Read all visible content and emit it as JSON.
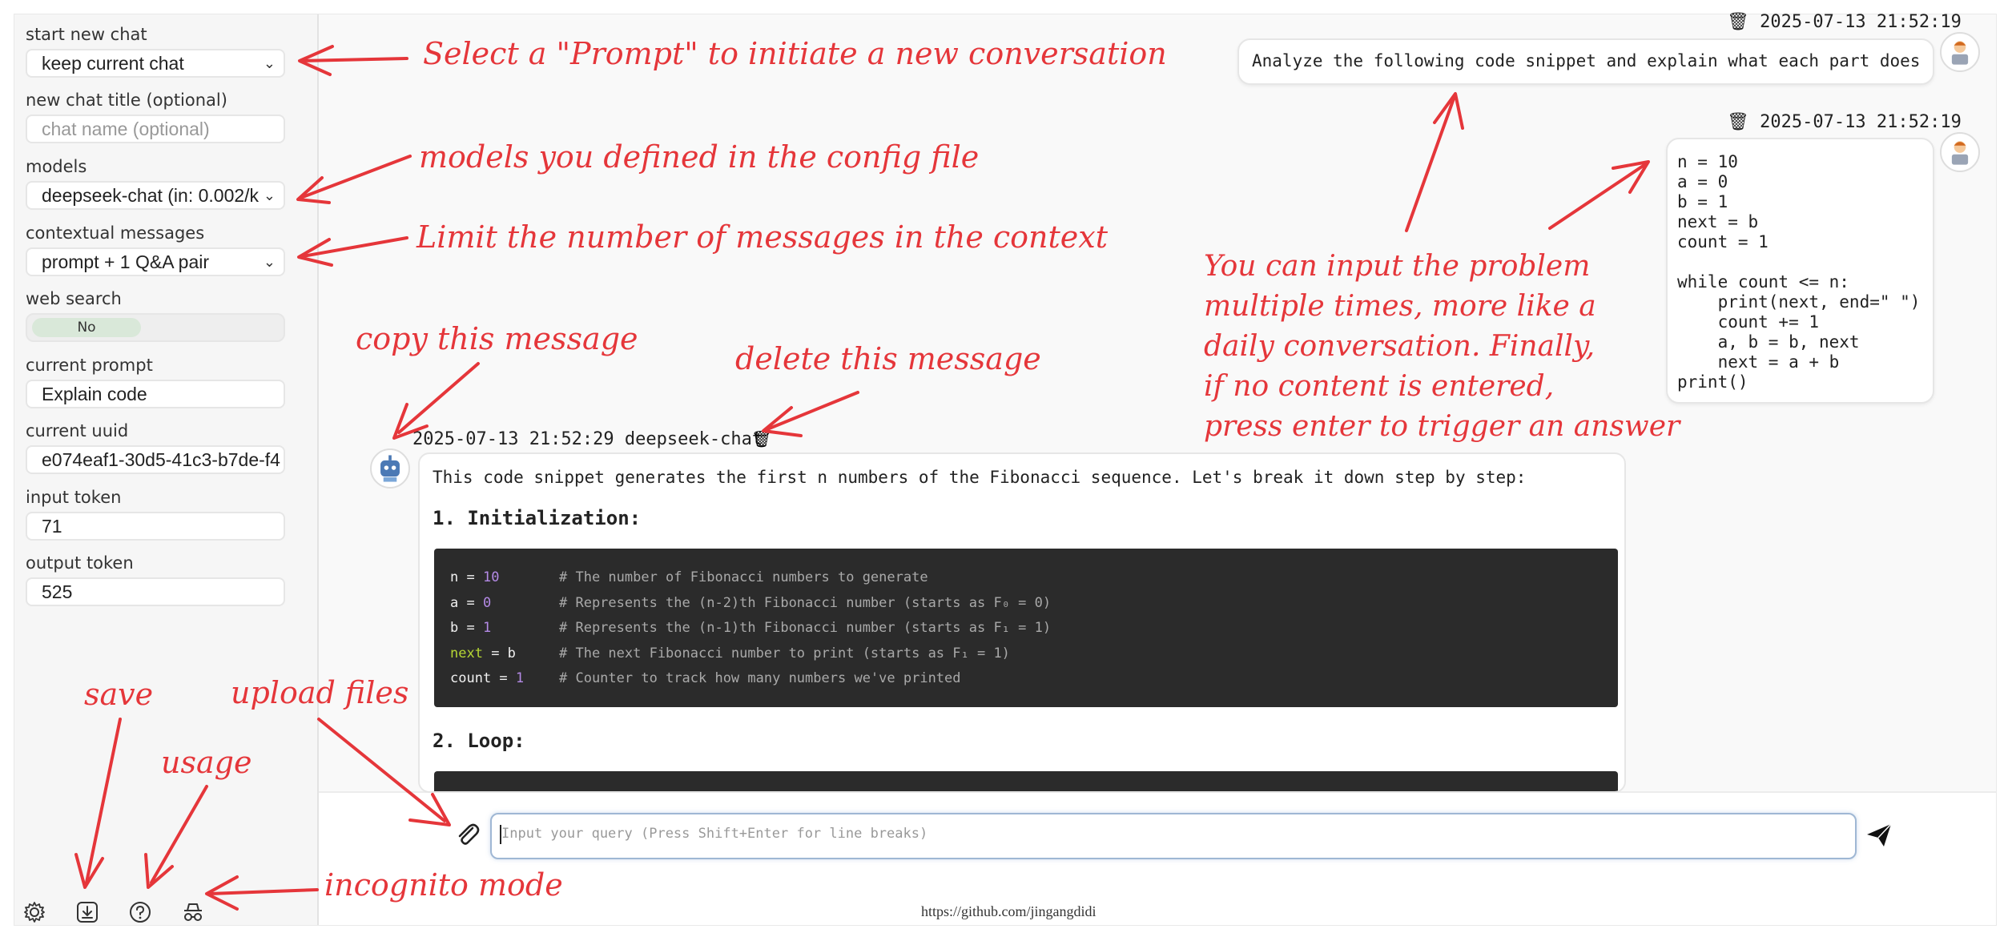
{
  "sidebar": {
    "start_chat_label": "start new chat",
    "start_chat_value": "keep current chat",
    "title_label": "new chat title (optional)",
    "title_placeholder": "chat name (optional)",
    "models_label": "models",
    "models_value": "deepseek-chat (in: 0.002/k, ",
    "context_label": "contextual messages",
    "context_value": "prompt + 1 Q&A pair",
    "web_search_label": "web search",
    "web_search_value": "No",
    "prompt_label": "current prompt",
    "prompt_value": "Explain code",
    "uuid_label": "current uuid",
    "uuid_value": "e074eaf1-30d5-41c3-b7de-f4",
    "input_token_label": "input token",
    "input_token_value": "71",
    "output_token_label": "output token",
    "output_token_value": "525"
  },
  "messages": {
    "user1": {
      "timestamp": "🗑 2025-07-13 21:52:19",
      "text": "Analyze the following code snippet and explain what each part does"
    },
    "user2": {
      "timestamp": "🗑 2025-07-13 21:52:19",
      "code": "n = 10\na = 0\nb = 1\nnext = b\ncount = 1\n\nwhile count <= n:\n    print(next, end=\" \")\n    count += 1\n    a, b = b, next\n    next = a + b\nprint()"
    },
    "bot": {
      "meta": "2025-07-13 21:52:29 deepseek-chat",
      "intro": "This code snippet generates the first n numbers of the Fibonacci sequence. Let's break it down step by step:",
      "heading1": "1. Initialization:",
      "heading2": "2. Loop:",
      "code": [
        {
          "var": "n",
          "val": "10",
          "comment": "# The number of Fibonacci numbers to generate"
        },
        {
          "var": "a",
          "val": "0",
          "comment": "# Represents the (n-2)th Fibonacci number (starts as F₀ = 0)"
        },
        {
          "var": "b",
          "val": "1",
          "comment": "# Represents the (n-1)th Fibonacci number (starts as F₁ = 1)"
        },
        {
          "var": "next",
          "val": "b",
          "comment": "# The next Fibonacci number to print (starts as F₁ = 1)"
        },
        {
          "var": "count",
          "val": "1",
          "comment": "# Counter to track how many numbers we've printed"
        }
      ]
    }
  },
  "input": {
    "placeholder": "Input your query (Press Shift+Enter for line breaks)"
  },
  "footer": {
    "link": "https://github.com/jingangdidi"
  },
  "annotations": {
    "prompt": "Select a \"Prompt\" to initiate a new conversation",
    "models": "models you defined in the config file",
    "context": "Limit the number of messages in the context",
    "copy": "copy this message",
    "delete": "delete this message",
    "multi": [
      "You can input the problem",
      "multiple times, more like a",
      "daily conversation. Finally,",
      "if no content is entered,",
      "press enter to trigger an answer"
    ],
    "save": "save",
    "upload": "upload files",
    "usage": "usage",
    "incognito": "incognito mode"
  },
  "colors": {
    "annotation": "#e5363a",
    "code_bg": "#2b2b2b",
    "number": "#b48ae6",
    "keyword": "#b5d634"
  }
}
